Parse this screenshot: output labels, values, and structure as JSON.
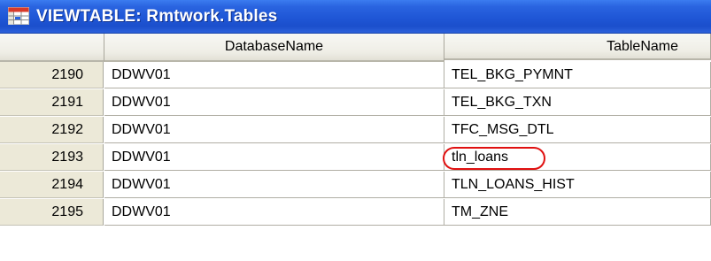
{
  "window": {
    "title": "VIEWTABLE: Rmtwork.Tables",
    "icon": "viewtable-grid-icon"
  },
  "table": {
    "columns": [
      "DatabaseName",
      "TableName"
    ],
    "rows": [
      {
        "row_num": "2190",
        "database_name": "DDWV01",
        "table_name": "TEL_BKG_PYMNT"
      },
      {
        "row_num": "2191",
        "database_name": "DDWV01",
        "table_name": "TEL_BKG_TXN"
      },
      {
        "row_num": "2192",
        "database_name": "DDWV01",
        "table_name": "TFC_MSG_DTL"
      },
      {
        "row_num": "2193",
        "database_name": "DDWV01",
        "table_name": "tln_loans"
      },
      {
        "row_num": "2194",
        "database_name": "DDWV01",
        "table_name": "TLN_LOANS_HIST"
      },
      {
        "row_num": "2195",
        "database_name": "DDWV01",
        "table_name": "TM_ZNE"
      }
    ],
    "highlighted_row_index": 3,
    "highlight_color": "#e01010"
  },
  "colors": {
    "titlebar": "#1f56d6",
    "header_bg": "#efeee6",
    "rownum_bg": "#ece9d8"
  }
}
